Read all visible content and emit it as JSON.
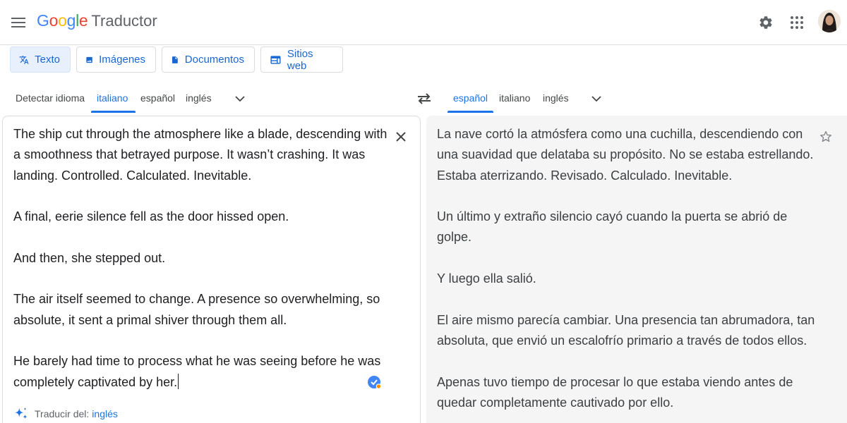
{
  "header": {
    "logo_parts": [
      {
        "char": "G",
        "color": "#4285F4"
      },
      {
        "char": "o",
        "color": "#EA4335"
      },
      {
        "char": "o",
        "color": "#FBBC05"
      },
      {
        "char": "g",
        "color": "#4285F4"
      },
      {
        "char": "l",
        "color": "#34A853"
      },
      {
        "char": "e",
        "color": "#EA4335"
      }
    ],
    "product": "Traductor",
    "icons": [
      "menu-icon",
      "settings-gear-icon",
      "apps-grid-icon",
      "avatar"
    ]
  },
  "modes": [
    {
      "label": "Texto",
      "icon": "translate-icon",
      "active": true
    },
    {
      "label": "Imágenes",
      "icon": "image-icon",
      "active": false
    },
    {
      "label": "Documentos",
      "icon": "document-icon",
      "active": false
    },
    {
      "label": "Sitios web",
      "icon": "website-icon",
      "active": false
    }
  ],
  "source_langs": {
    "items": [
      "Detectar idioma",
      "italiano",
      "español",
      "inglés"
    ],
    "selected": "italiano"
  },
  "target_langs": {
    "items": [
      "español",
      "italiano",
      "inglés"
    ],
    "selected": "español"
  },
  "source": {
    "paragraphs": [
      "The ship cut through the atmosphere like a blade, descending with a smoothness that betrayed purpose. It wasn’t crashing. It was landing. Controlled. Calculated. Inevitable.",
      "A final, eerie silence fell as the door hissed open.",
      "And then, she stepped out.",
      "The air itself seemed to change. A presence so overwhelming, so absolute, it sent a primal shiver through them all.",
      "He barely had time to process what he was seeing before he was completely captivated by her."
    ]
  },
  "target": {
    "paragraphs": [
      "La nave cortó la atmósfera como una cuchilla, descendiendo con una suavidad que delataba su propósito. No se estaba estrellando. Estaba aterrizando. Revisado. Calculado. Inevitable.",
      "Un último y extraño silencio cayó cuando la puerta se abrió de golpe.",
      "Y luego ella salió.",
      "El aire mismo parecía cambiar. Una presencia tan abrumadora, tan absoluta, que envió un escalofrío primario a través de todos ellos.",
      "Apenas tuvo tiempo de procesar lo que estaba viendo antes de quedar completamente cautivado por ello."
    ]
  },
  "suggestion": {
    "prefix": "Traducir del:",
    "lang": "inglés"
  },
  "colors": {
    "accent": "#1a73e8",
    "active_tab_bg": "#e8f0fe",
    "target_bg": "#f5f5f5"
  }
}
